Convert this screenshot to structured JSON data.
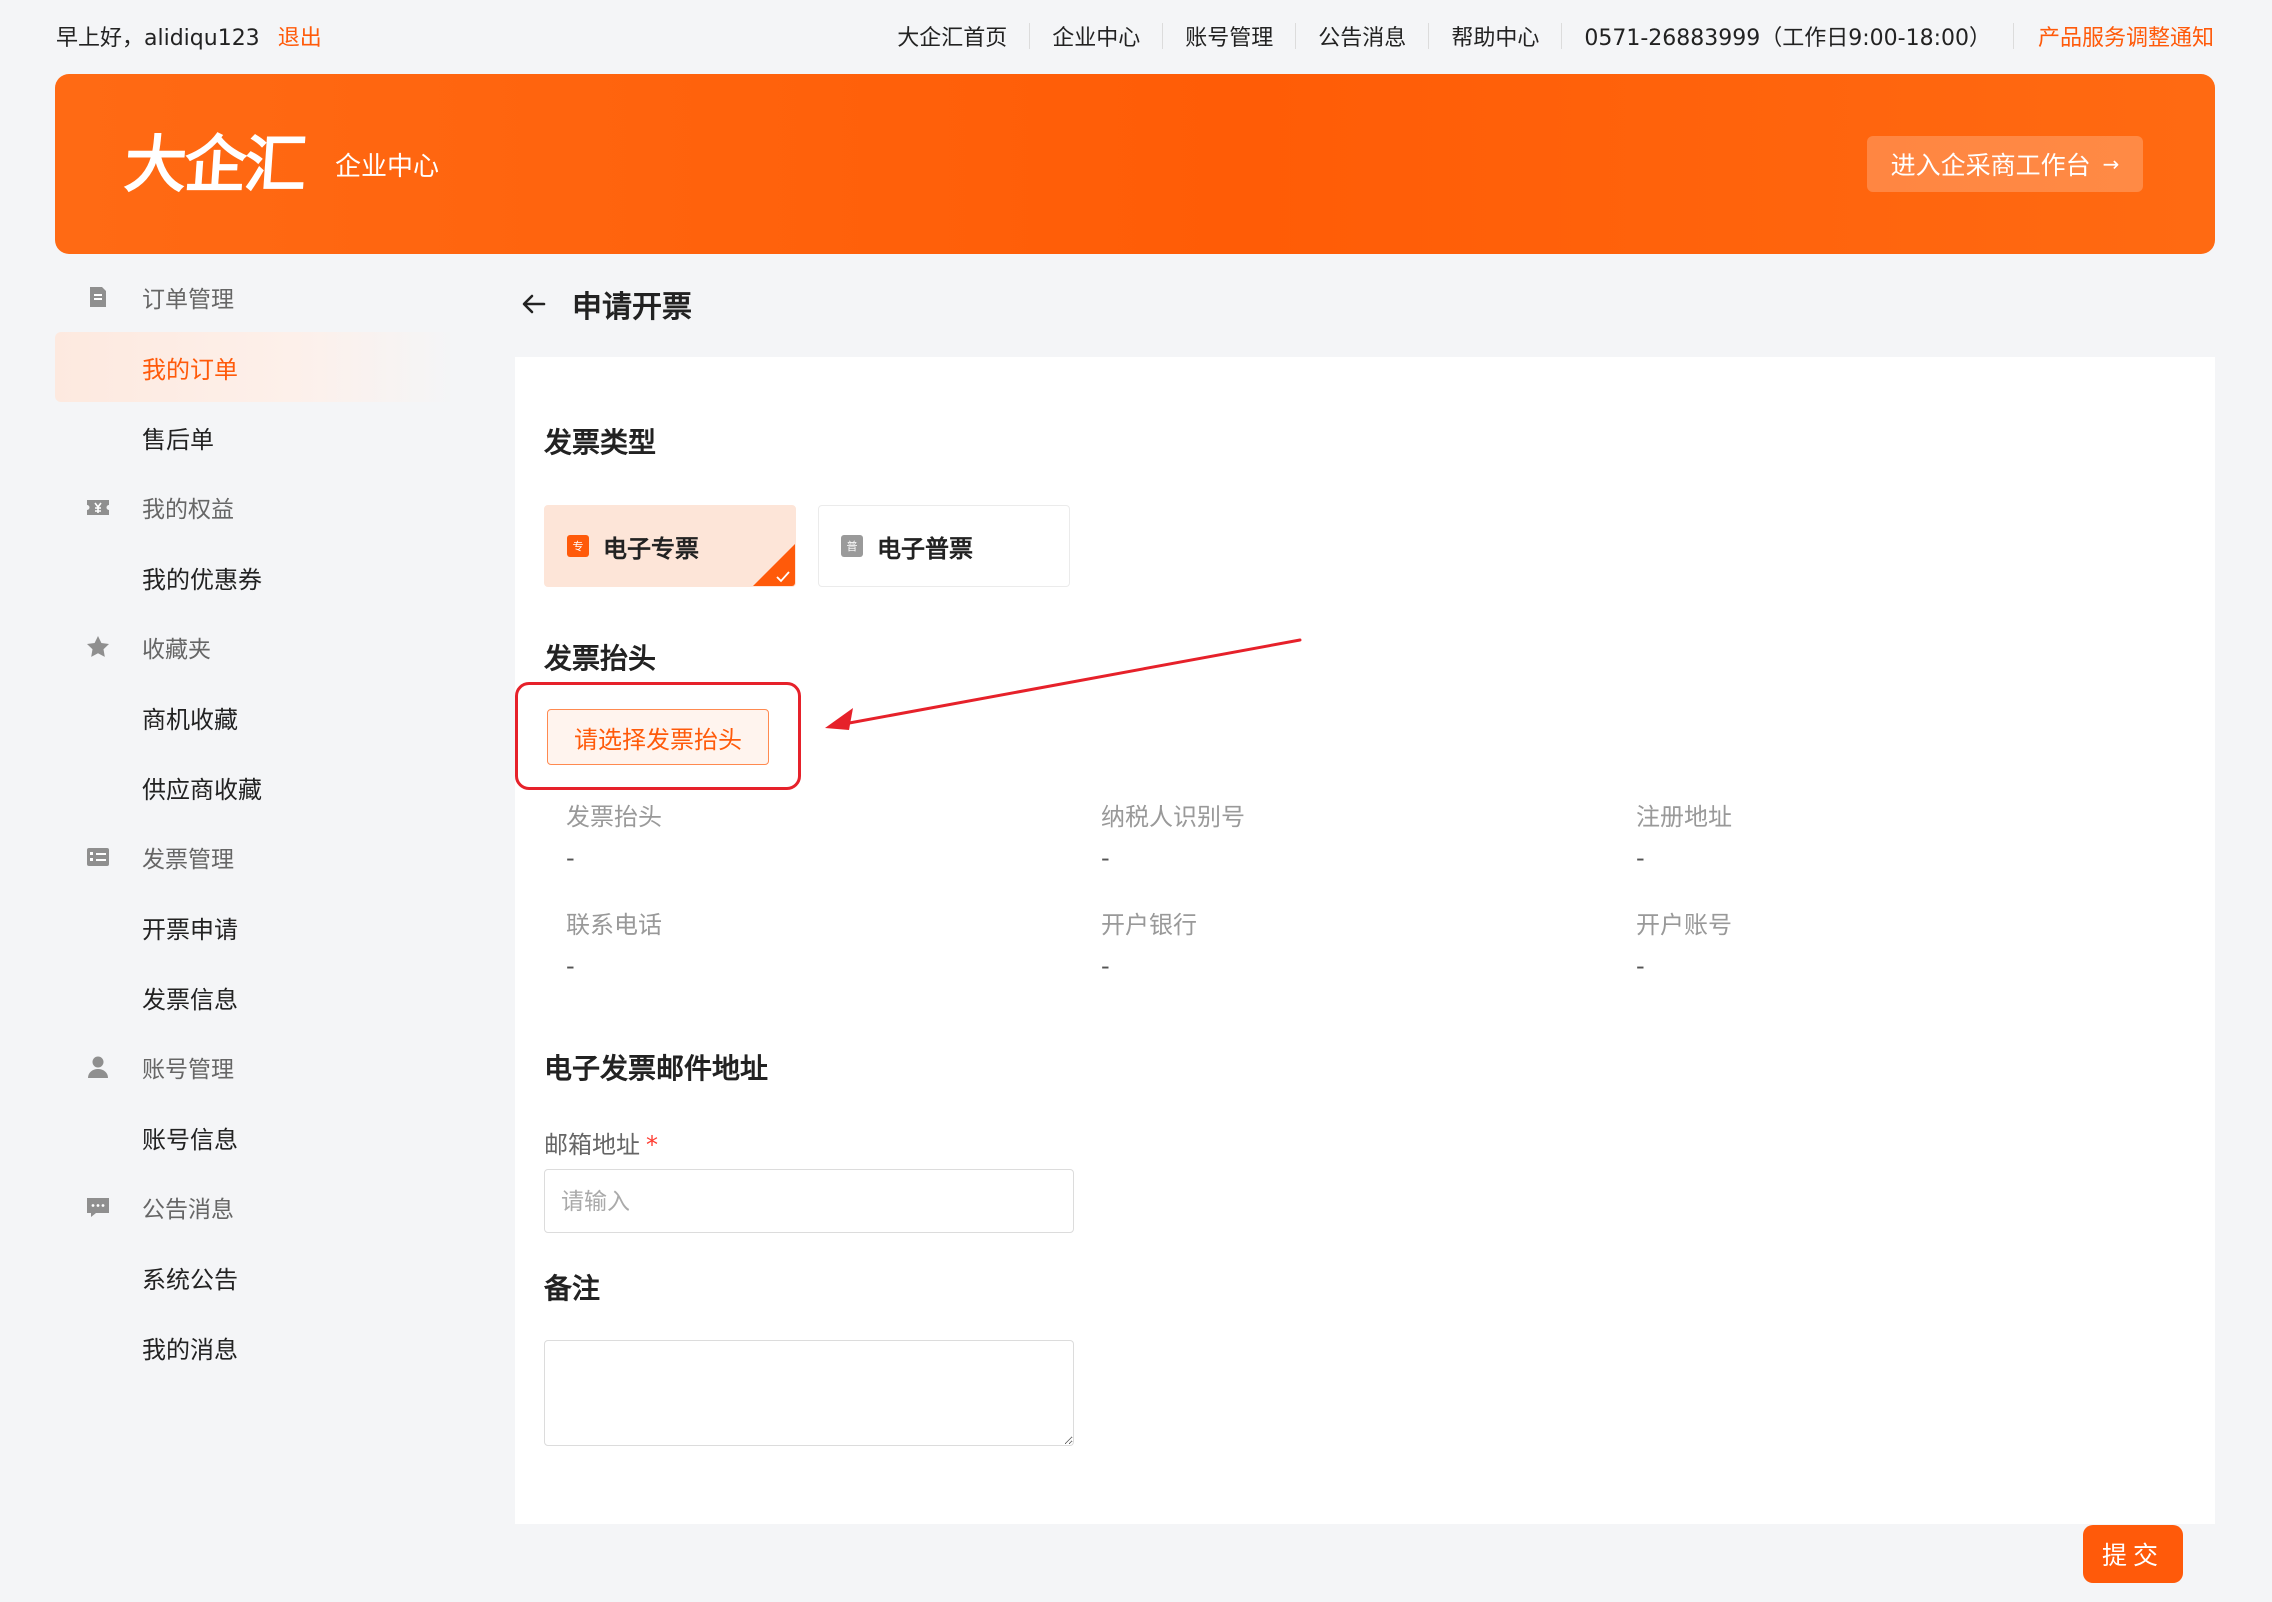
{
  "topbar": {
    "greeting": "早上好，alidiqu123",
    "logout": "退出",
    "nav": [
      "大企汇首页",
      "企业中心",
      "账号管理",
      "公告消息",
      "帮助中心"
    ],
    "phone": "0571-26883999（工作日9:00-18:00）",
    "notice": "产品服务调整通知"
  },
  "banner": {
    "logo": "大企汇",
    "subtitle": "企业中心",
    "workbench_button": "进入企采商工作台",
    "workbench_arrow": "→"
  },
  "sidebar": {
    "groups": [
      {
        "title": "订单管理",
        "icon": "document-icon",
        "items": [
          "我的订单",
          "售后单"
        ]
      },
      {
        "title": "我的权益",
        "icon": "yen-ticket-icon",
        "items": [
          "我的优惠券"
        ]
      },
      {
        "title": "收藏夹",
        "icon": "star-icon",
        "items": [
          "商机收藏",
          "供应商收藏"
        ]
      },
      {
        "title": "发票管理",
        "icon": "invoice-list-icon",
        "items": [
          "开票申请",
          "发票信息"
        ]
      },
      {
        "title": "账号管理",
        "icon": "user-icon",
        "items": [
          "账号信息"
        ]
      },
      {
        "title": "公告消息",
        "icon": "message-icon",
        "items": [
          "系统公告",
          "我的消息"
        ]
      }
    ],
    "active_item": "我的订单"
  },
  "page": {
    "title": "申请开票",
    "sections": {
      "invoice_type": "发票类型",
      "invoice_header": "发票抬头",
      "email": "电子发票邮件地址",
      "remark": "备注"
    },
    "invoice_types": [
      {
        "label": "电子专票",
        "badge": "专",
        "selected": true
      },
      {
        "label": "电子普票",
        "badge": "普",
        "selected": false
      }
    ],
    "choose_header_button": "请选择发票抬头",
    "header_fields": [
      {
        "label": "发票抬头",
        "value": "-"
      },
      {
        "label": "纳税人识别号",
        "value": "-"
      },
      {
        "label": "注册地址",
        "value": "-"
      },
      {
        "label": "联系电话",
        "value": "-"
      },
      {
        "label": "开户银行",
        "value": "-"
      },
      {
        "label": "开户账号",
        "value": "-"
      }
    ],
    "email_label": "邮箱地址",
    "email_required_mark": "*",
    "email_placeholder": "请输入",
    "email_value": "",
    "remark_value": "",
    "submit": "提交"
  },
  "colors": {
    "brand": "#ff5a0a",
    "annotation_red": "#e6212a",
    "selected_bg": "#fde5d8",
    "page_bg": "#f4f5f7"
  }
}
